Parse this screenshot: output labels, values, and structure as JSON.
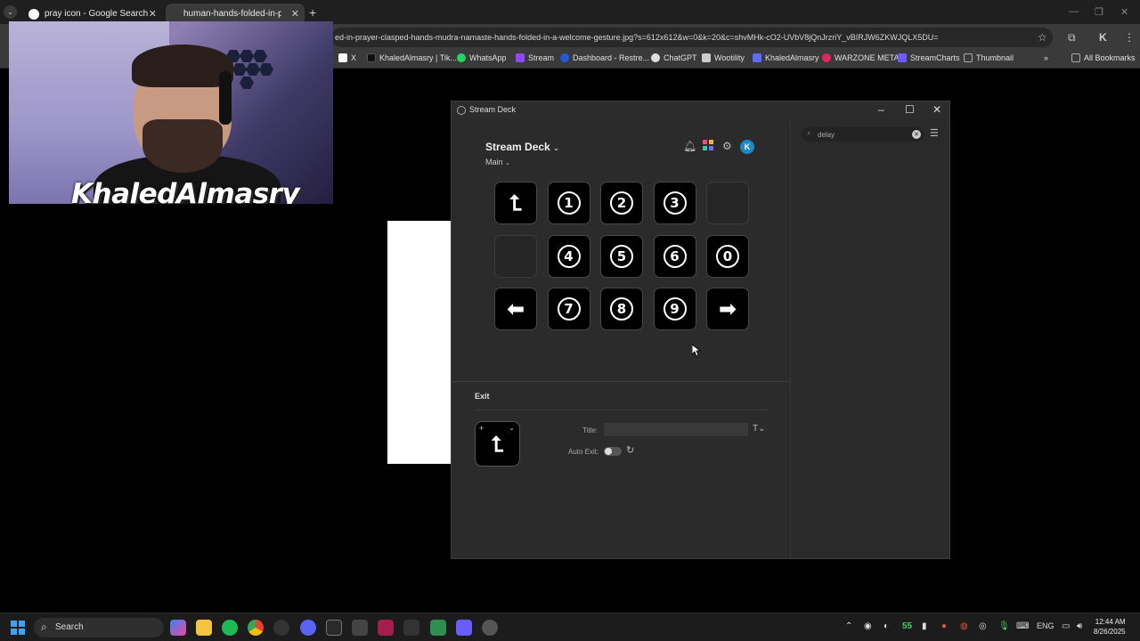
{
  "browser": {
    "tabs": [
      {
        "title": "pray icon - Google Search",
        "favicon_color": "#ffffff"
      },
      {
        "title": "human-hands-folded-in-prayer",
        "favicon_color": "#3a3a3a"
      }
    ],
    "address": "ed-in-prayer-clasped-hands-mudra-namaste-hands-folded-in-a-welcome-gesture.jpg?s=612x612&w=0&k=20&c=shvMHk-cO2-UVbV8jQnJrzriY_vBIRJW6ZKWJQLX5DU=",
    "bookmarks": [
      {
        "label": "X",
        "color": "#ffffff"
      },
      {
        "label": "KhaledAlmasry | Tik...",
        "color": "#222222"
      },
      {
        "label": "WhatsApp",
        "color": "#25d366"
      },
      {
        "label": "Stream",
        "color": "#9146ff"
      },
      {
        "label": "Dashboard - Restre...",
        "color": "#1e5bd8"
      },
      {
        "label": "ChatGPT",
        "color": "#dddddd"
      },
      {
        "label": "Wootility",
        "color": "#cccccc"
      },
      {
        "label": "KhaledAlmasry",
        "color": "#5b6cff"
      },
      {
        "label": "WARZONE META",
        "color": "#e0245e"
      },
      {
        "label": "StreamCharts",
        "color": "#6a5cff"
      },
      {
        "label": "Thumbnail",
        "color": "#aaaaaa"
      }
    ],
    "all_bookmarks": "All Bookmarks"
  },
  "webcam": {
    "name": "KhaledAlmasry"
  },
  "streamdeck": {
    "window_title": "Stream Deck",
    "device": "Stream Deck",
    "profile": "Main",
    "avatar_letter": "K",
    "keys": [
      {
        "type": "glyph",
        "label": "⮤"
      },
      {
        "type": "num",
        "label": "1"
      },
      {
        "type": "num",
        "label": "2"
      },
      {
        "type": "num",
        "label": "3"
      },
      {
        "type": "empty",
        "label": ""
      },
      {
        "type": "empty",
        "label": ""
      },
      {
        "type": "num",
        "label": "4"
      },
      {
        "type": "num",
        "label": "5"
      },
      {
        "type": "num",
        "label": "6"
      },
      {
        "type": "num",
        "label": "0"
      },
      {
        "type": "glyph",
        "label": "⬅"
      },
      {
        "type": "num",
        "label": "7"
      },
      {
        "type": "num",
        "label": "8"
      },
      {
        "type": "num",
        "label": "9"
      },
      {
        "type": "glyph",
        "label": "➡"
      }
    ],
    "search_value": "delay",
    "inspector": {
      "action_name": "Exit",
      "title_label": "Title:",
      "title_value": "",
      "auto_exit_label": "Auto Exit:",
      "auto_exit_on": false
    }
  },
  "taskbar": {
    "search_label": "Search",
    "tray_number": "55",
    "language": "ENG",
    "time": "12:44 AM",
    "date": "8/26/2025"
  }
}
